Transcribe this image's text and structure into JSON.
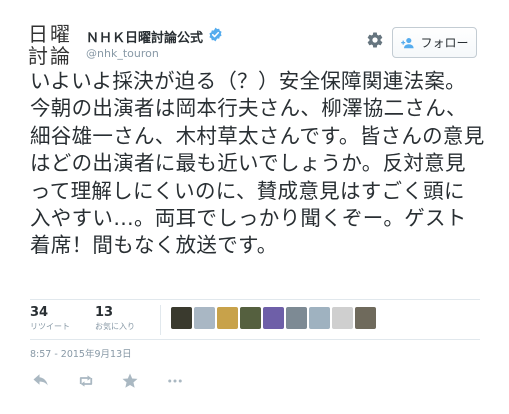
{
  "account": {
    "avatar_chars": [
      "日",
      "曜",
      "討",
      "論"
    ],
    "name": "ＮＨＫ日曜討論公式",
    "handle": "@nhk_touron",
    "verified_icon": "verified-badge-icon"
  },
  "toolbar": {
    "settings_icon": "gear-icon",
    "follow_label": "フォロー",
    "follow_icon": "follow-person-icon"
  },
  "tweet": {
    "text": "いよいよ採決が迫る（？）安全保障関連法案。今朝の出演者は岡本行夫さん、柳澤協二さん、細谷雄一さん、木村草太さんです。皆さんの意見はどの出演者に最も近いでしょうか。反対意見って理解しにくいのに、賛成意見はすごく頭に入やすい…。両耳でしっかり聞くぞー。ゲスト着席！間もなく放送です。",
    "timestamp": "8:57 - 2015年9月13日"
  },
  "stats": {
    "retweets": {
      "count": "34",
      "label": "リツイート"
    },
    "favorites": {
      "count": "13",
      "label": "お気に入り"
    }
  },
  "favoriters": [
    {
      "name": "favoriter-avatar-1",
      "color": "#3a3a2e"
    },
    {
      "name": "favoriter-avatar-2",
      "color": "#a9b7c4"
    },
    {
      "name": "favoriter-avatar-3",
      "color": "#c8a24a"
    },
    {
      "name": "favoriter-avatar-4",
      "color": "#55603f"
    },
    {
      "name": "favoriter-avatar-5",
      "color": "#6e5fa8"
    },
    {
      "name": "favoriter-avatar-6",
      "color": "#7d8a94"
    },
    {
      "name": "favoriter-avatar-7",
      "color": "#9fb2c0"
    },
    {
      "name": "favoriter-avatar-8",
      "color": "#cfcfcf"
    },
    {
      "name": "favoriter-avatar-9",
      "color": "#6f6a5c"
    }
  ],
  "actions": [
    {
      "name": "reply-icon"
    },
    {
      "name": "retweet-icon"
    },
    {
      "name": "favorite-star-icon"
    },
    {
      "name": "more-options-icon"
    }
  ],
  "colors": {
    "text": "#292f33",
    "muted": "#8899a6",
    "accent": "#55acee",
    "divider": "#e1e8ed",
    "action_icon": "#aab8c2"
  }
}
